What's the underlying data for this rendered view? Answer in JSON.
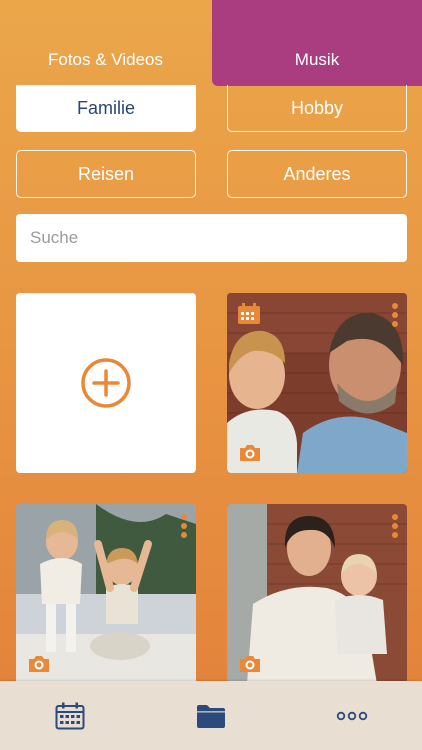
{
  "tabs": [
    {
      "label": "Fotos & Videos",
      "active": false
    },
    {
      "label": "Musik",
      "active": true
    }
  ],
  "categories": [
    "Familie",
    "Hobby",
    "Reisen",
    "Anderes"
  ],
  "selected_category": "Familie",
  "search": {
    "placeholder": "Suche",
    "value": ""
  },
  "colors": {
    "accent_orange": "#e8893a",
    "tab_active": "#a93d80",
    "chip_active_text": "#2b4575",
    "icon_blue": "#2c4a7c"
  },
  "icons": {
    "add": "plus-circle-icon",
    "calendar": "calendar-icon",
    "menu": "more-vertical-icon",
    "camera": "camera-icon",
    "folder": "folder-icon",
    "more": "more-horizontal-icon"
  },
  "bottom_nav": [
    {
      "name": "calendar",
      "active": false
    },
    {
      "name": "folder",
      "active": true
    },
    {
      "name": "more",
      "active": false
    }
  ]
}
